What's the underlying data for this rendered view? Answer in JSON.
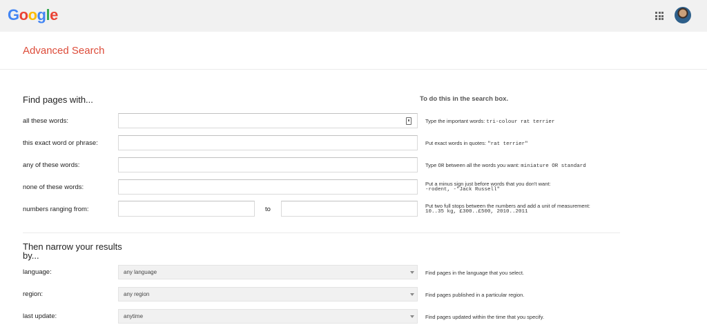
{
  "header": {
    "logo_letters": [
      {
        "ch": "G",
        "color": "#4285f4"
      },
      {
        "ch": "o",
        "color": "#ea4335"
      },
      {
        "ch": "o",
        "color": "#fbbc05"
      },
      {
        "ch": "g",
        "color": "#4285f4"
      },
      {
        "ch": "l",
        "color": "#34a853"
      },
      {
        "ch": "e",
        "color": "#ea4335"
      }
    ],
    "apps_icon": "apps-grid-icon",
    "avatar_icon": "account-avatar-icon"
  },
  "page": {
    "title": "Advanced Search",
    "accent_color": "#dd4b39"
  },
  "find": {
    "heading": "Find pages with...",
    "hint_heading": "To do this in the search box.",
    "rows": [
      {
        "label": "all these words:",
        "value": "",
        "hint_text": "Type the important words: ",
        "hint_code": "tri-colour rat terrier"
      },
      {
        "label": "this exact word or phrase:",
        "value": "",
        "hint_text": "Put exact words in quotes: ",
        "hint_code": "\"rat terrier\""
      },
      {
        "label": "any of these words:",
        "value": "",
        "hint_text_1": "Type ",
        "hint_code_1": "OR",
        "hint_text_2": " between all the words you want: ",
        "hint_code_2": "miniature OR standard"
      },
      {
        "label": "none of these words:",
        "value": "",
        "hint_line1": "Put a minus sign just before words that you don't want:",
        "hint_line2": "-rodent, -\"Jack Russell\""
      },
      {
        "label": "numbers ranging from:",
        "from_value": "",
        "to_label": "to",
        "to_value": "",
        "hint_line1": "Put two full stops between the numbers and add a unit of measurement:",
        "hint_line2": "10..35 kg, £300..£500, 2010..2011"
      }
    ]
  },
  "narrow": {
    "heading_line1": "Then narrow your results",
    "heading_line2": "by...",
    "rows": [
      {
        "label": "language:",
        "selected": "any language",
        "hint": "Find pages in the language that you select."
      },
      {
        "label": "region:",
        "selected": "any region",
        "hint": "Find pages published in a particular region."
      },
      {
        "label": "last update:",
        "selected": "anytime",
        "hint": "Find pages updated within the time that you specify."
      }
    ]
  }
}
